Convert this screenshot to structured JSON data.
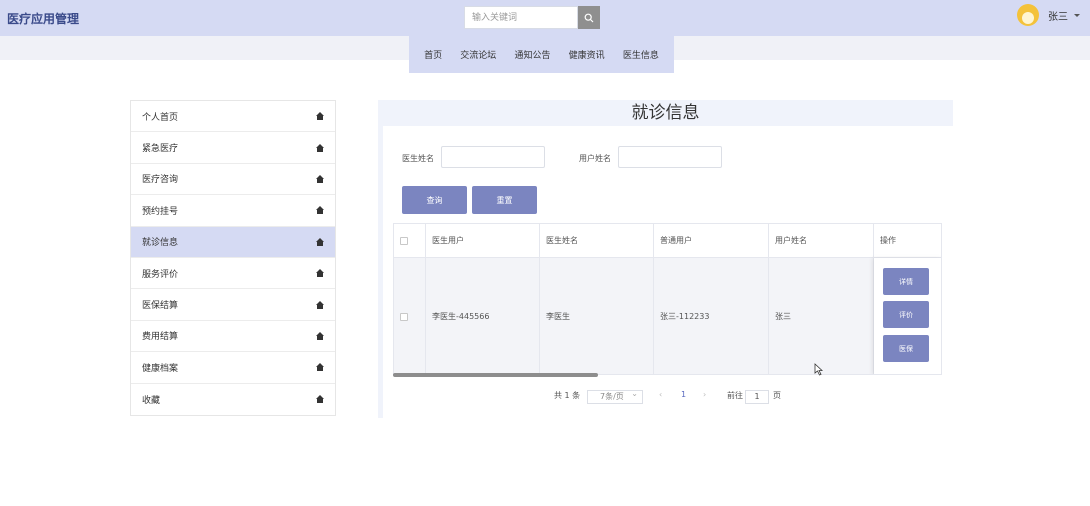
{
  "header": {
    "brand": "医疗应用管理",
    "search_placeholder": "输入关键词",
    "user_name": "张三"
  },
  "topnav": [
    "首页",
    "交流论坛",
    "通知公告",
    "健康资讯",
    "医生信息"
  ],
  "sidebar": {
    "items": [
      {
        "label": "个人首页"
      },
      {
        "label": "紧急医疗"
      },
      {
        "label": "医疗咨询"
      },
      {
        "label": "预约挂号"
      },
      {
        "label": "就诊信息",
        "active": true
      },
      {
        "label": "服务评价"
      },
      {
        "label": "医保结算"
      },
      {
        "label": "费用结算"
      },
      {
        "label": "健康档案"
      },
      {
        "label": "收藏"
      }
    ]
  },
  "main": {
    "title": "就诊信息",
    "filters": {
      "doctor_name_label": "医生姓名",
      "user_name_label": "用户姓名"
    },
    "buttons": {
      "query": "查询",
      "reset": "重置"
    },
    "table": {
      "headers": [
        "医生用户",
        "医生姓名",
        "普通用户",
        "用户姓名",
        "操作"
      ],
      "rows": [
        {
          "doctor_user": "李医生-445566",
          "doctor_name": "李医生",
          "user": "张三-112233",
          "user_name": "张三"
        }
      ],
      "actions": [
        "详情",
        "评价",
        "医保"
      ]
    },
    "pager": {
      "total": "共 1 条",
      "page_size": "7条/页",
      "current_page": "1",
      "goto_label": "前往",
      "goto_value": "1",
      "page_suffix": "页"
    }
  }
}
